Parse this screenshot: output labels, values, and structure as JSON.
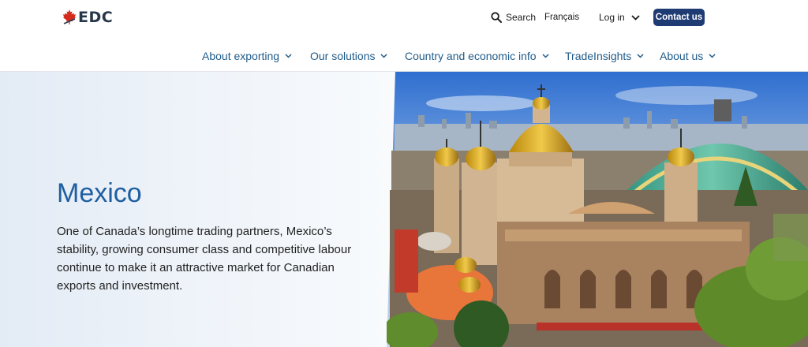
{
  "logo": {
    "text": "EDC"
  },
  "utility": {
    "search_label": "Search",
    "language_label": "Français",
    "login_label": "Log in",
    "contact_label": "Contact us"
  },
  "nav": {
    "items": [
      {
        "label": "About exporting"
      },
      {
        "label": "Our solutions"
      },
      {
        "label": "Country and economic info"
      },
      {
        "label": "TradeInsights"
      },
      {
        "label": "About us"
      }
    ]
  },
  "hero": {
    "title": "Mexico",
    "description": "One of Canada’s longtime trading partners, Mexico’s stability, growing consumer class and competitive labour continue to make it an attractive market for Canadian exports and investment."
  },
  "colors": {
    "brand_navy": "#1f3b73",
    "link_blue": "#1f5b8a",
    "title_blue": "#1f5fa0",
    "maple_red": "#d52b1e"
  },
  "icons": [
    "maple-leaf-icon",
    "search-icon",
    "chevron-down-icon"
  ]
}
